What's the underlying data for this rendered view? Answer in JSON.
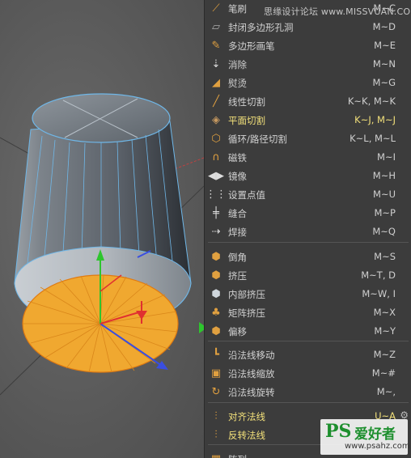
{
  "watermark_top": "思缘设计论坛 www.MISSVUAN.COM",
  "watermark_bottom": {
    "ps": "PS",
    "cn": "爱好者",
    "url": "www.psahz.com"
  },
  "menu": {
    "items": [
      {
        "label": "笔刷",
        "shortcut": "M~C",
        "icon": "brush-icon"
      },
      {
        "label": "封闭多边形孔洞",
        "shortcut": "M~D",
        "icon": "close-hole-icon"
      },
      {
        "label": "多边形画笔",
        "shortcut": "M~E",
        "icon": "polygon-pen-icon"
      },
      {
        "label": "消除",
        "shortcut": "M~N",
        "icon": "dissolve-icon"
      },
      {
        "label": "熨烫",
        "shortcut": "M~G",
        "icon": "iron-icon"
      },
      {
        "label": "线性切割",
        "shortcut": "K~K, M~K",
        "icon": "line-cut-icon"
      },
      {
        "label": "平面切割",
        "shortcut": "K~J, M~J",
        "icon": "plane-cut-icon",
        "highlight": true
      },
      {
        "label": "循环/路径切割",
        "shortcut": "K~L, M~L",
        "icon": "loop-cut-icon"
      },
      {
        "label": "磁铁",
        "shortcut": "M~I",
        "icon": "magnet-icon"
      },
      {
        "label": "镜像",
        "shortcut": "M~H",
        "icon": "mirror-icon"
      },
      {
        "label": "设置点值",
        "shortcut": "M~U",
        "icon": "set-point-value-icon"
      },
      {
        "label": "缝合",
        "shortcut": "M~P",
        "icon": "stitch-icon"
      },
      {
        "label": "焊接",
        "shortcut": "M~Q",
        "icon": "weld-icon"
      },
      {
        "label": "倒角",
        "shortcut": "M~S",
        "icon": "bevel-icon"
      },
      {
        "label": "挤压",
        "shortcut": "M~T, D",
        "icon": "extrude-icon"
      },
      {
        "label": "内部挤压",
        "shortcut": "M~W, I",
        "icon": "extrude-inner-icon"
      },
      {
        "label": "矩阵挤压",
        "shortcut": "M~X",
        "icon": "matrix-extrude-icon"
      },
      {
        "label": "偏移",
        "shortcut": "M~Y",
        "icon": "offset-icon"
      },
      {
        "label": "沿法线移动",
        "shortcut": "M~Z",
        "icon": "normal-move-icon"
      },
      {
        "label": "沿法线缩放",
        "shortcut": "M~#",
        "icon": "normal-scale-icon"
      },
      {
        "label": "沿法线旋转",
        "shortcut": "M~,",
        "icon": "normal-rotate-icon"
      },
      {
        "label": "对齐法线",
        "shortcut": "U~A",
        "icon": "align-normals-icon",
        "highlight": true
      },
      {
        "label": "反转法线",
        "shortcut": "",
        "icon": "reverse-normals-icon",
        "highlight": true
      },
      {
        "label": "阵列",
        "shortcut": "",
        "icon": "array-icon"
      }
    ]
  },
  "colors": {
    "menu_bg": "#3c3c3c",
    "menu_text": "#d2d2d2",
    "highlight_text": "#f2e07a",
    "selection_fill": "#f0a830",
    "wire": "#6fb7e8",
    "axis_y": "#2ec52e",
    "axis_x": "#e03030",
    "axis_z": "#3a4ee0"
  }
}
